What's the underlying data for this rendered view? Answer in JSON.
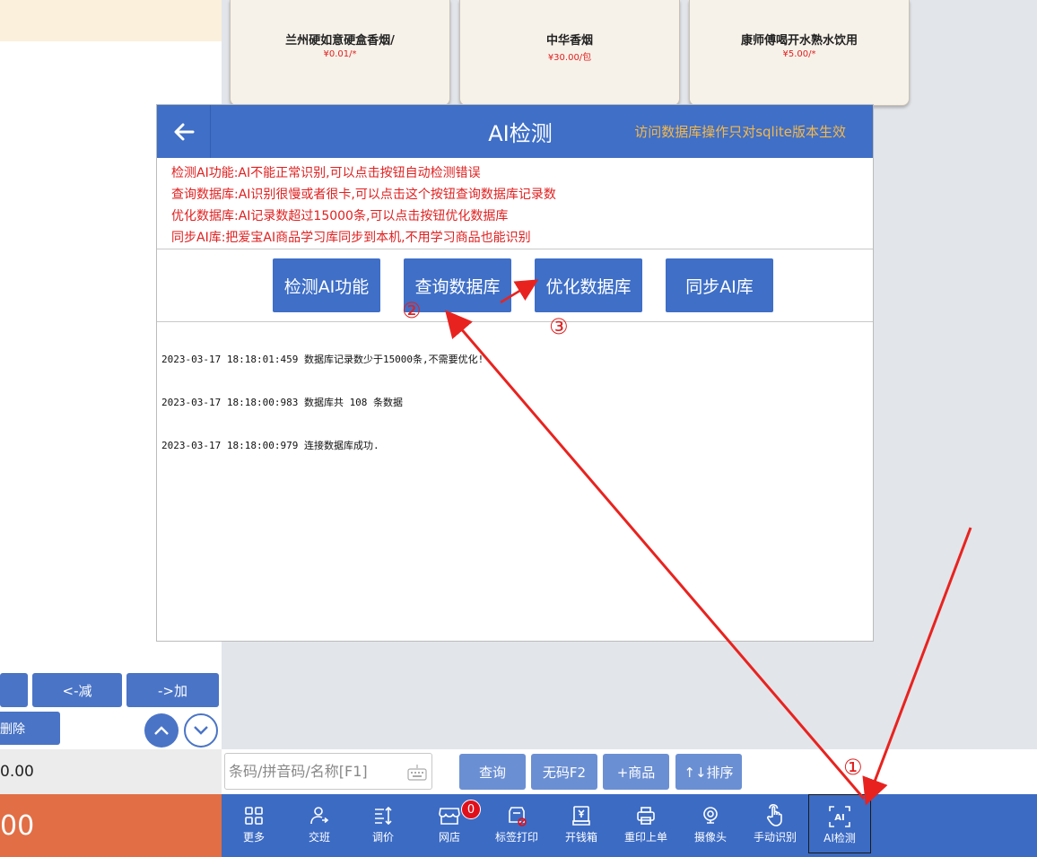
{
  "products": [
    {
      "name": "兰州硬如意硬盒香烟/",
      "price": "¥0.01/*"
    },
    {
      "name": "中华香烟",
      "price": "¥30.00/包"
    },
    {
      "name": "康师傅喝开水熟水饮用",
      "price": "¥5.00/*"
    }
  ],
  "left": {
    "decrease_label": "<-减",
    "increase_label": "->加",
    "delete_label": "删除",
    "total_value": "0.00",
    "pay_value": "00"
  },
  "dialog": {
    "title": "AI检测",
    "warning": "访问数据库操作只对sqlite版本生效",
    "descriptions": [
      "检测AI功能:AI不能正常识别,可以点击按钮自动检测错误",
      "查询数据库:AI识别很慢或者很卡,可以点击这个按钮查询数据库记录数",
      "优化数据库:AI记录数超过15000条,可以点击按钮优化数据库",
      "同步AI库:把爱宝AI商品学习库同步到本机,不用学习商品也能识别"
    ],
    "buttons": {
      "detect": "检测AI功能",
      "query": "查询数据库",
      "optimize": "优化数据库",
      "sync": "同步AI库"
    },
    "logs": [
      "2023-03-17 18:18:01:459 数据库记录数少于15000条,不需要优化!",
      "2023-03-17 18:18:00:983 数据库共 108 条数据",
      "2023-03-17 18:18:00:979 连接数据库成功."
    ]
  },
  "input_row": {
    "search_placeholder": "条码/拼音码/名称[F1]",
    "query_label": "查询",
    "nocode_label": "无码F2",
    "add_product_label": "+商品",
    "sort_label": "↑↓排序"
  },
  "toolbar": {
    "more": "更多",
    "shift": "交班",
    "price_adjust": "调价",
    "online_store": "网店",
    "online_store_badge": "0",
    "label_print": "标签打印",
    "cash_drawer": "开钱箱",
    "reprint": "重印上单",
    "camera": "摄像头",
    "manual_recognize": "手动识别",
    "ai_detect": "AI检测"
  },
  "annotations": {
    "step1": "①",
    "step2": "②",
    "step3": "③"
  },
  "colors": {
    "primary": "#3f6fc7",
    "toolbar": "#3c6bc4",
    "pay": "#e26e45",
    "warning": "#f5b84a",
    "annotation": "#e02020"
  }
}
